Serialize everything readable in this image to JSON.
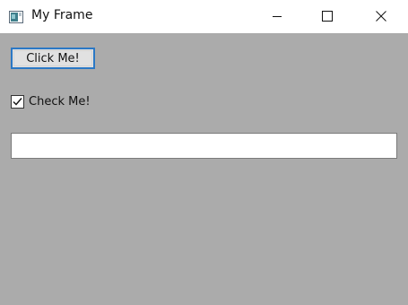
{
  "window": {
    "title": "My Frame",
    "icon": "java-window-icon",
    "controls": {
      "minimize_icon": "minimize-icon",
      "maximize_icon": "maximize-icon",
      "close_icon": "close-icon"
    }
  },
  "client": {
    "background": "#ababab",
    "button": {
      "label": "Click Me!",
      "focused": true,
      "focus_color": "#2b78c5"
    },
    "checkbox": {
      "label": "Check Me!",
      "checked": true
    },
    "text_field": {
      "value": "",
      "placeholder": ""
    }
  }
}
